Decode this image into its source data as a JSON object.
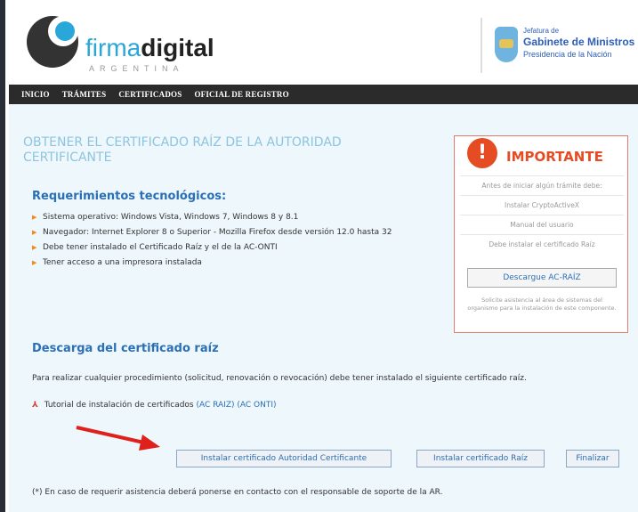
{
  "header": {
    "brand_light": "firma",
    "brand_bold": "digital",
    "brand_sub": "ARGENTINA",
    "gov_line1": "Jefatura de",
    "gov_line2": "Gabinete de Ministros",
    "gov_line3": "Presidencia de la Nación"
  },
  "nav": {
    "items": [
      "INICIO",
      "TRÁMITES",
      "CERTIFICADOS",
      "OFICIAL DE REGISTRO"
    ]
  },
  "main": {
    "title": "OBTENER EL CERTIFICADO RAÍZ DE LA AUTORIDAD CERTIFICANTE",
    "requirements_title": "Requerimientos tecnológicos:",
    "requirements": [
      "Sistema operativo: Windows Vista, Windows 7, Windows 8 y 8.1",
      "Navegador: Internet Explorer 8 o Superior - Mozilla Firefox desde versión 12.0 hasta 32",
      "Debe tener instalado el Certificado Raíz y el de la AC-ONTI",
      "Tener acceso a una impresora instalada"
    ],
    "download_title": "Descarga del certificado raíz",
    "download_text": "Para realizar cualquier procedimiento (solicitud, renovación o revocación) debe tener instalado el siguiente certificado raíz.",
    "tutorial_label": "Tutorial de instalación de certificados",
    "tutorial_link1": "(AC RAIZ)",
    "tutorial_link2": "(AC ONTI)",
    "buttons": {
      "install_ac": "Instalar certificado Autoridad Certificante",
      "install_root": "Instalar certificado Raíz",
      "finish": "Finalizar"
    },
    "footnote": "(*) En caso de requerir asistencia deberá ponerse en contacto con el responsable de soporte de la AR."
  },
  "important": {
    "icon": "!",
    "title": "IMPORTANTE",
    "rows": [
      "Antes de iniciar algún trámite debe:",
      "Instalar CryptoActiveX",
      "Manual del usuario",
      "Debe instalar el certificado Raíz"
    ],
    "button": "Descargue AC-RAÍZ",
    "note": "Solicite asistencia al área de sistemas del organismo para la instalación de este componente."
  },
  "colors": {
    "accent": "#2aa7d9",
    "link": "#2b6fb5",
    "important": "#e64c24",
    "navbar": "#2b2b2b",
    "content_bg": "#edf7fc"
  }
}
